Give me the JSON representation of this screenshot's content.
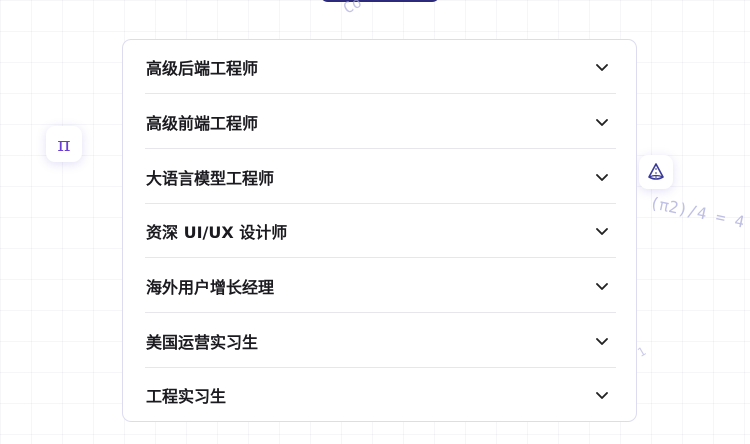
{
  "decorations": {
    "top_text": "Co",
    "formula_text": "(π2)/4 = 4",
    "one_text": "1",
    "pi_symbol": "π",
    "accent_color": "#6b3fd6"
  },
  "accordion": {
    "items": [
      {
        "label": "高级后端工程师",
        "icon": "chevron-down-icon"
      },
      {
        "label": "高级前端工程师",
        "icon": "chevron-down-icon"
      },
      {
        "label": "大语言模型工程师",
        "icon": "chevron-down-icon"
      },
      {
        "label": "资深 UI/UX 设计师",
        "icon": "chevron-down-icon"
      },
      {
        "label": "海外用户增长经理",
        "icon": "chevron-down-icon"
      },
      {
        "label": "美国运营实习生",
        "icon": "chevron-down-icon"
      },
      {
        "label": "工程实习生",
        "icon": "chevron-down-icon"
      }
    ]
  }
}
